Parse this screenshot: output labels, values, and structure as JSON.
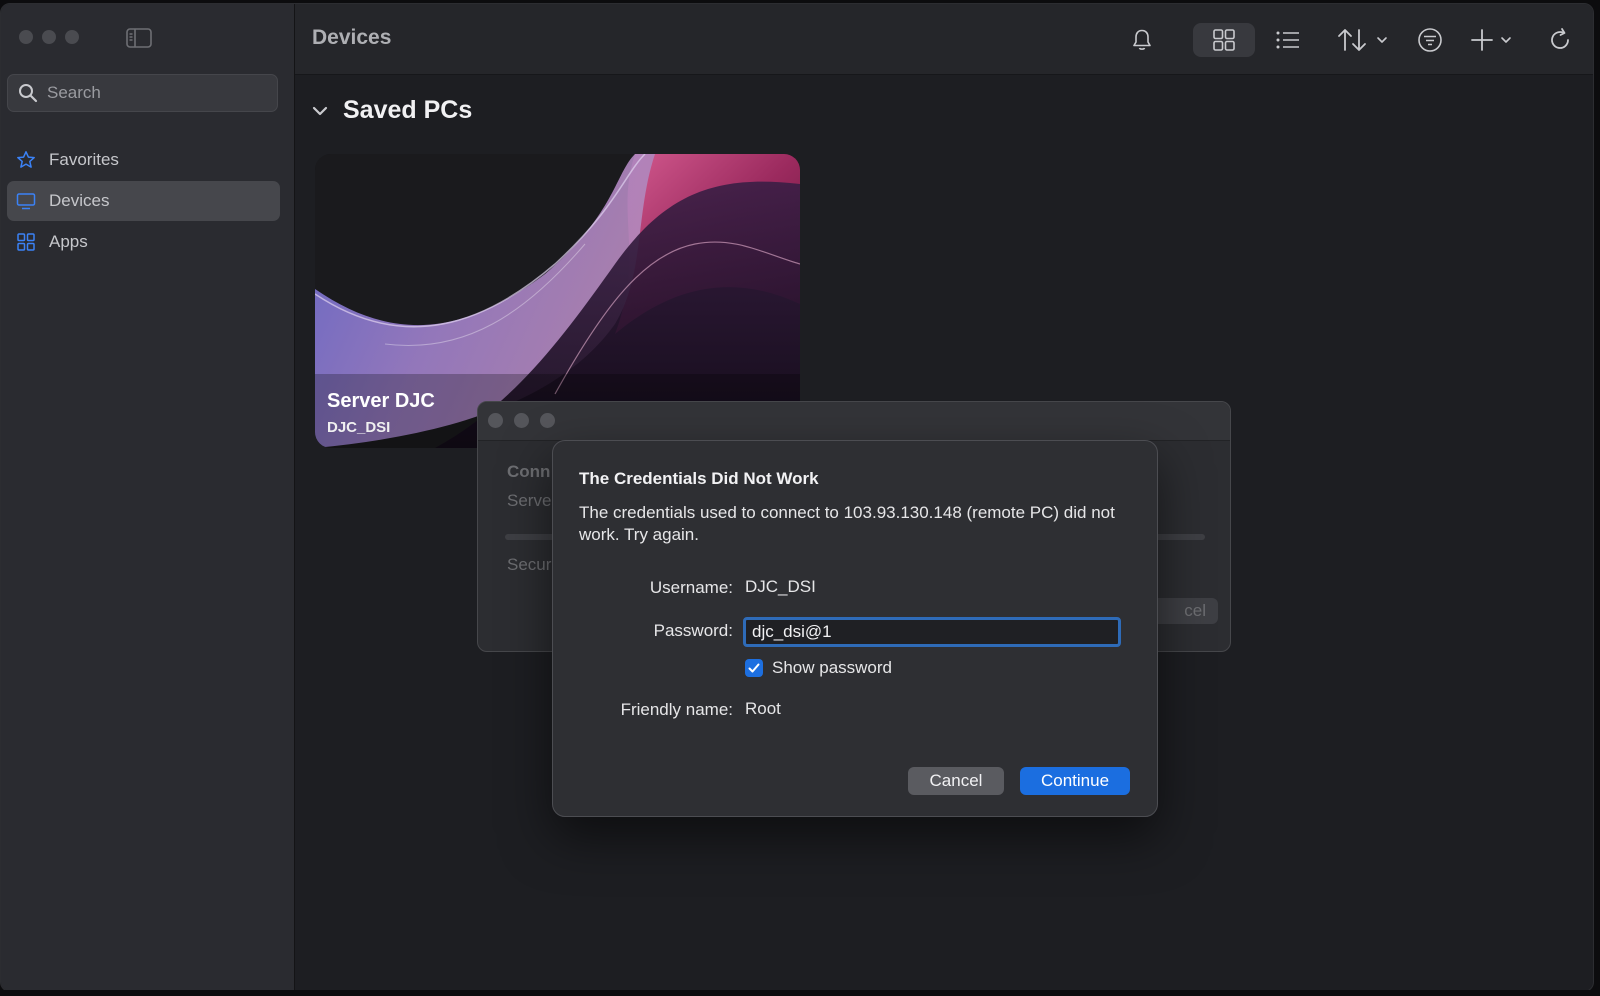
{
  "sidebar": {
    "search_placeholder": "Search",
    "items": [
      {
        "label": "Favorites",
        "icon": "star-icon"
      },
      {
        "label": "Devices",
        "icon": "monitor-icon",
        "active": true
      },
      {
        "label": "Apps",
        "icon": "apps-grid-icon"
      }
    ]
  },
  "toolbar": {
    "title": "Devices",
    "icons": [
      "bell-icon",
      "grid-view-icon",
      "list-view-icon",
      "sort-icon",
      "filter-icon",
      "add-icon",
      "refresh-icon"
    ]
  },
  "section": {
    "title": "Saved PCs"
  },
  "device_card": {
    "name": "Server DJC",
    "username": "DJC_DSI"
  },
  "background_sheet": {
    "text1": "Conn",
    "text2": "Serve",
    "text3": "Secur",
    "cancel": "cel"
  },
  "dialog": {
    "title": "The Credentials Did Not Work",
    "message": "The credentials used to connect to 103.93.130.148 (remote PC) did not work. Try again.",
    "username_label": "Username:",
    "username_value": "DJC_DSI",
    "password_label": "Password:",
    "password_value": "djc_dsi@1",
    "show_password_label": "Show password",
    "show_password_checked": true,
    "friendly_name_label": "Friendly name:",
    "friendly_name_value": "Root",
    "cancel_label": "Cancel",
    "continue_label": "Continue"
  },
  "colors": {
    "accent": "#1b6ee0",
    "focus_ring": "#2e6bb8"
  }
}
